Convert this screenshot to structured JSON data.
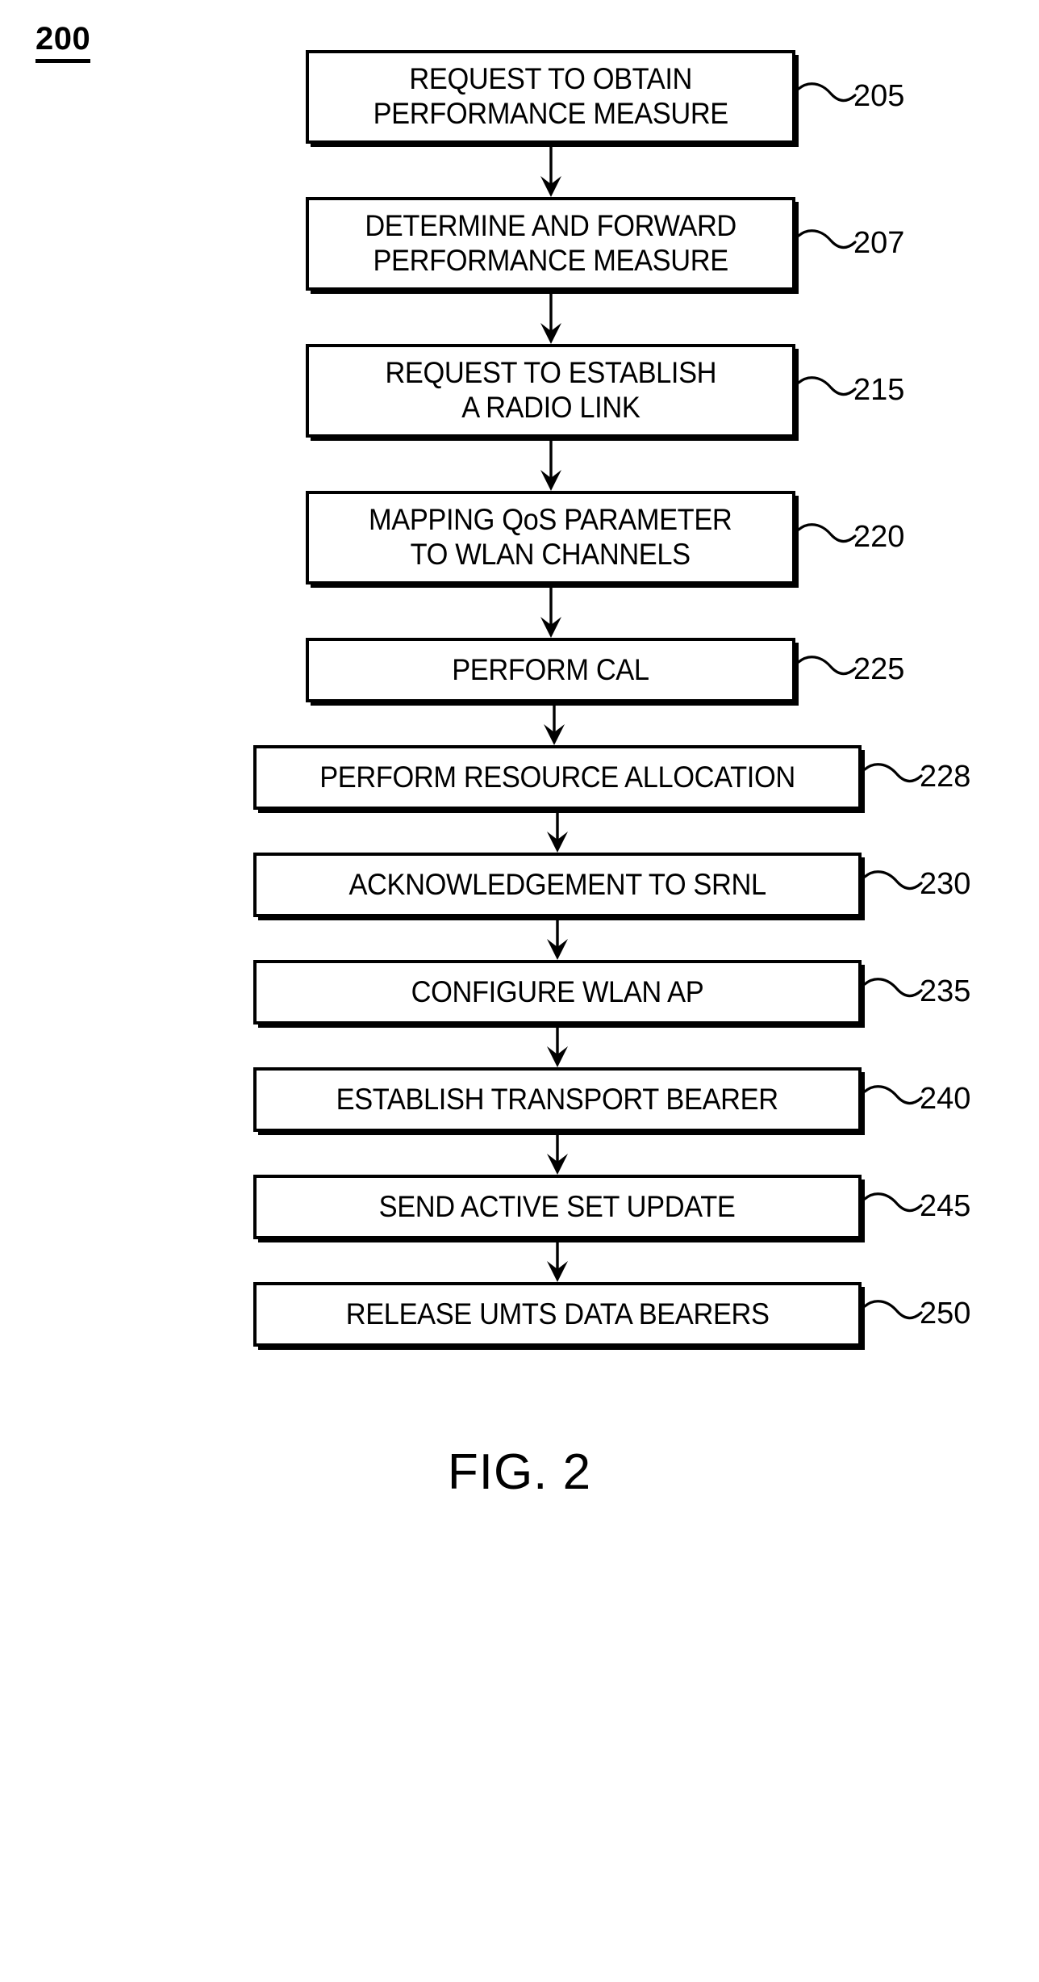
{
  "figure": {
    "ref_number": "200",
    "caption": "FIG. 2",
    "type": "patent-flowchart",
    "orientation": "vertical-single-column",
    "background_color": "#ffffff",
    "line_color": "#000000"
  },
  "steps": [
    {
      "ref": "205",
      "label": "REQUEST TO OBTAIN\nPERFORMANCE MEASURE",
      "lines": 2,
      "width_class": "narrow"
    },
    {
      "ref": "207",
      "label": "DETERMINE AND FORWARD\nPERFORMANCE MEASURE",
      "lines": 2,
      "width_class": "narrow"
    },
    {
      "ref": "215",
      "label": "REQUEST TO ESTABLISH\nA RADIO LINK",
      "lines": 2,
      "width_class": "narrow"
    },
    {
      "ref": "220",
      "label": "MAPPING QoS PARAMETER\nTO WLAN CHANNELS",
      "lines": 2,
      "width_class": "narrow"
    },
    {
      "ref": "225",
      "label": "PERFORM CAL",
      "lines": 1,
      "width_class": "narrow"
    },
    {
      "ref": "228",
      "label": "PERFORM RESOURCE ALLOCATION",
      "lines": 1,
      "width_class": "wide"
    },
    {
      "ref": "230",
      "label": "ACKNOWLEDGEMENT TO SRNL",
      "lines": 1,
      "width_class": "wide"
    },
    {
      "ref": "235",
      "label": "CONFIGURE WLAN AP",
      "lines": 1,
      "width_class": "wide"
    },
    {
      "ref": "240",
      "label": "ESTABLISH TRANSPORT BEARER",
      "lines": 1,
      "width_class": "wide"
    },
    {
      "ref": "245",
      "label": "SEND ACTIVE SET UPDATE",
      "lines": 1,
      "width_class": "wide"
    },
    {
      "ref": "250",
      "label": "RELEASE UMTS DATA BEARERS",
      "lines": 1,
      "width_class": "wide"
    }
  ],
  "connectors": [
    {
      "from": "205",
      "to": "207",
      "kind": "arrow-down"
    },
    {
      "from": "207",
      "to": "215",
      "kind": "arrow-down"
    },
    {
      "from": "215",
      "to": "220",
      "kind": "arrow-down"
    },
    {
      "from": "220",
      "to": "225",
      "kind": "arrow-down"
    },
    {
      "from": "225",
      "to": "228",
      "kind": "arrow-down"
    },
    {
      "from": "228",
      "to": "230",
      "kind": "arrow-down"
    },
    {
      "from": "230",
      "to": "235",
      "kind": "arrow-down"
    },
    {
      "from": "235",
      "to": "240",
      "kind": "arrow-down"
    },
    {
      "from": "240",
      "to": "245",
      "kind": "arrow-down"
    },
    {
      "from": "245",
      "to": "250",
      "kind": "arrow-down"
    }
  ]
}
